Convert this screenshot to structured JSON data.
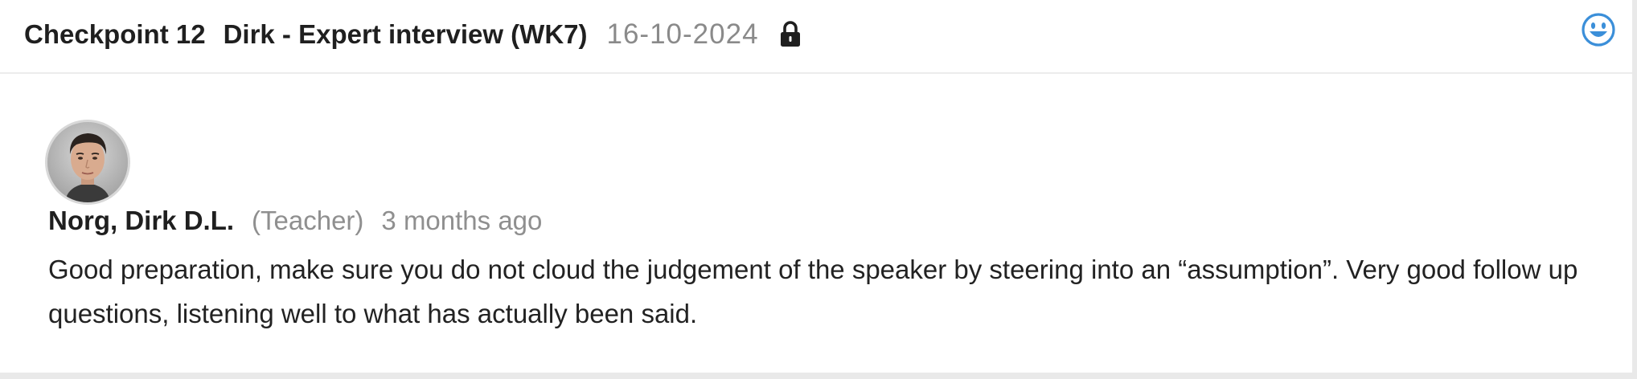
{
  "header": {
    "checkpoint_label": "Checkpoint 12",
    "checkpoint_name": "Dirk - Expert interview (WK7)",
    "date": "16-10-2024",
    "lock_icon": "lock-icon",
    "reaction_icon": "smiley-icon"
  },
  "comment": {
    "author": "Norg, Dirk D.L.",
    "role": "(Teacher)",
    "time": "3 months ago",
    "text": "Good preparation, make sure you do not cloud the judgement of the speaker by steering into an “assumption”. Very good follow up questions, listening well to what has actually been said."
  },
  "colors": {
    "title": "#1f1f1f",
    "muted": "#8a8a8a",
    "accent": "#3b8fd9",
    "divider": "#ececec"
  }
}
